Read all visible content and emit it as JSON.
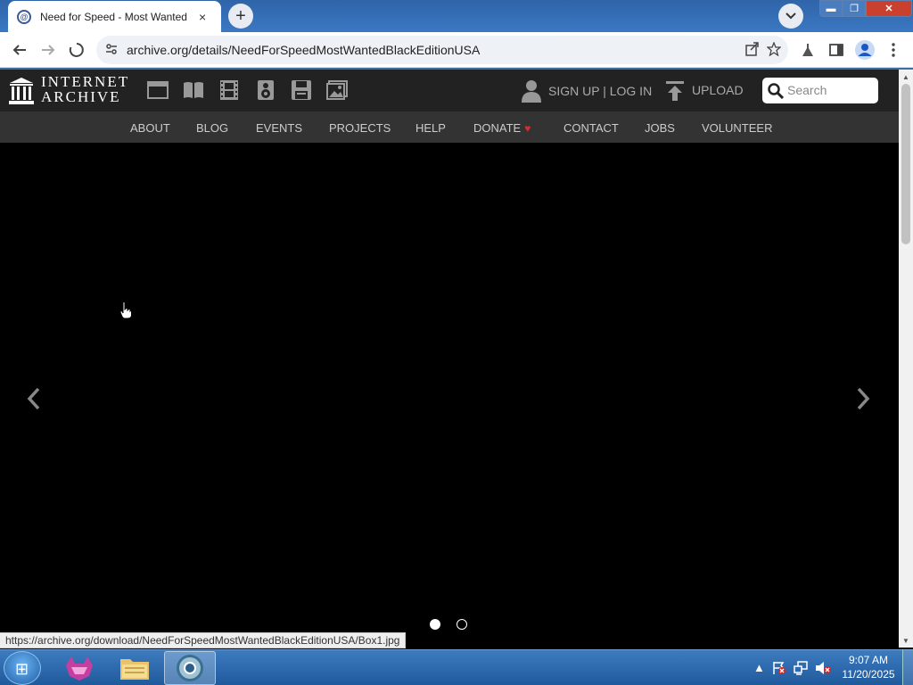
{
  "browser": {
    "tab_title": "Need for Speed - Most Wanted",
    "tab_close": "×",
    "new_tab": "+",
    "url": "archive.org/details/NeedForSpeedMostWantedBlackEditionUSA",
    "window_controls": {
      "minimize": "▬",
      "maximize": "❐",
      "close": "✕"
    }
  },
  "ia_header": {
    "logo_line1": "INTERNET",
    "logo_line2": "ARCHIVE",
    "media_icons": [
      "web-icon",
      "texts-icon",
      "video-icon",
      "audio-icon",
      "software-icon",
      "images-icon"
    ],
    "signup_login": "SIGN UP | LOG IN",
    "upload": "UPLOAD",
    "search_placeholder": "Search"
  },
  "nav": {
    "items": [
      "ABOUT",
      "BLOG",
      "EVENTS",
      "PROJECTS",
      "HELP",
      "DONATE",
      "CONTACT",
      "JOBS",
      "VOLUNTEER"
    ]
  },
  "viewer": {
    "prev": "‹",
    "next": "›",
    "slides": 2,
    "current_slide": 1
  },
  "status_bar": {
    "link": "https://archive.org/download/NeedForSpeedMostWantedBlackEditionUSA/Box1.jpg"
  },
  "taskbar": {
    "time": "9:07 AM",
    "date": "11/20/2025"
  },
  "colors": {
    "ia_header_bg": "#222222",
    "ia_nav_bg": "#333333",
    "donate_heart": "#e0282f",
    "taskbar": "#2a6bb0"
  }
}
